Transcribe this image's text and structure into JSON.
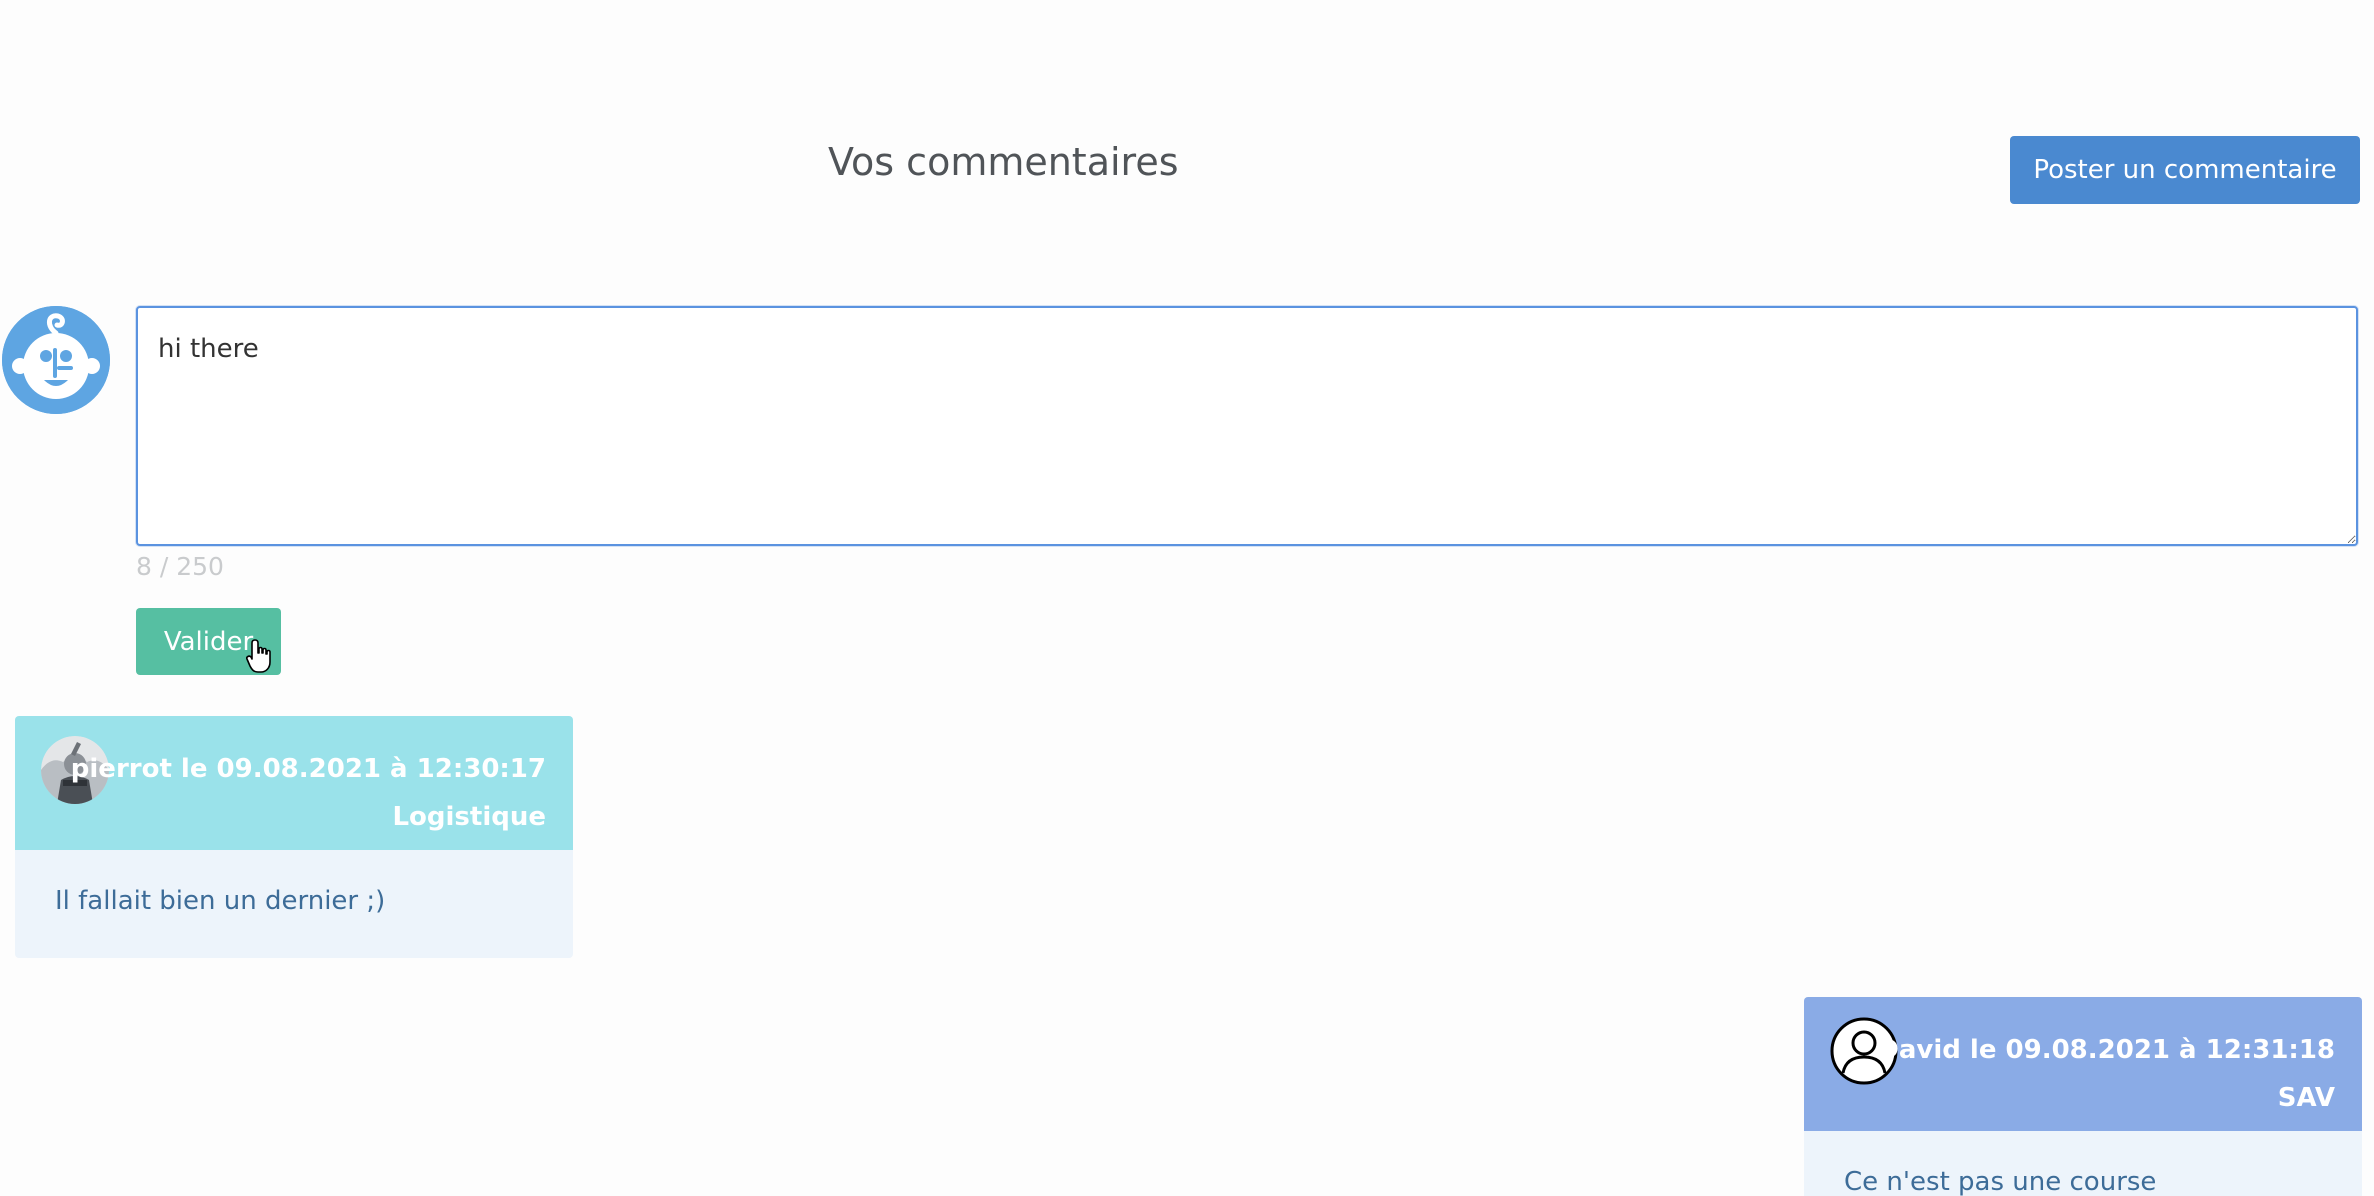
{
  "header": {
    "title": "Vos commentaires",
    "post_button_label": "Poster un commentaire"
  },
  "composer": {
    "text": "hi there",
    "char_count": "8 / 250",
    "submit_label": "Valider"
  },
  "comments": [
    {
      "meta": "pierrot le 09.08.2021 à 12:30:17",
      "department": "Logistique",
      "body": "Il fallait bien un dernier ;)"
    },
    {
      "meta": "David le 09.08.2021 à 12:31:18",
      "department": "SAV",
      "body": "Ce n'est pas une course"
    }
  ],
  "colors": {
    "primary": "#4a89d0",
    "success": "#56bfa2",
    "card_header_1": "#9ae2ea",
    "card_header_2": "#8aabe6",
    "card_body": "#edf4fb"
  }
}
